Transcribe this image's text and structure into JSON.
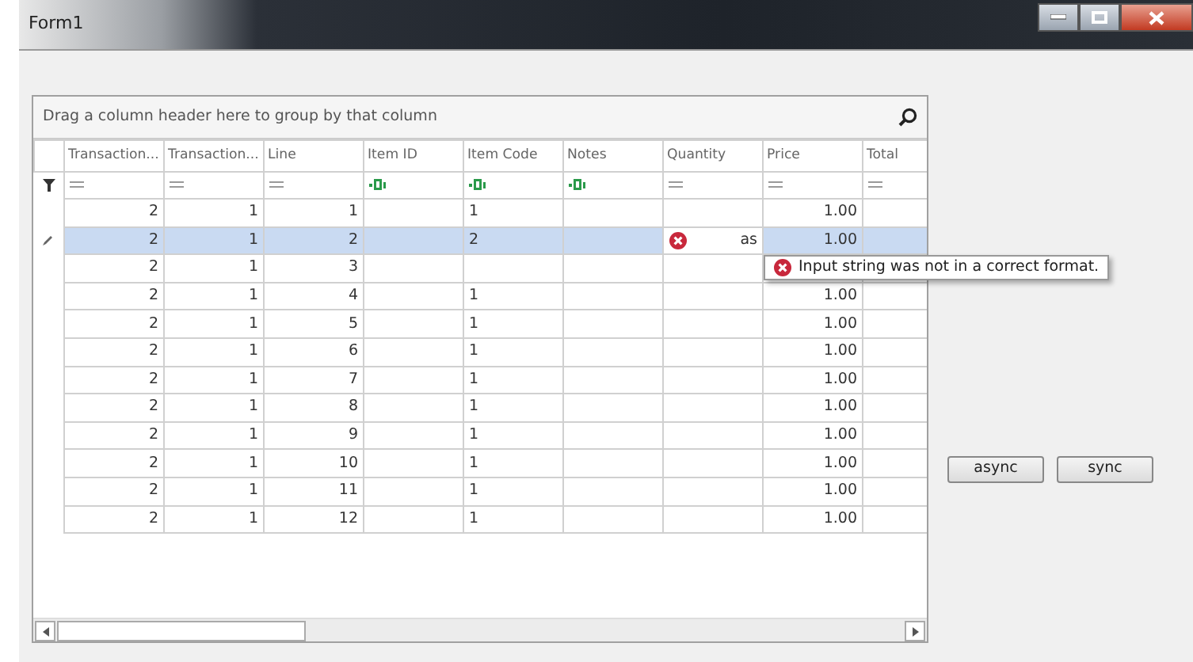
{
  "window": {
    "title": "Form1"
  },
  "grid": {
    "group_panel": "Drag a column header here to group by that column",
    "columns": [
      {
        "label": "Transaction...",
        "kind": "numeric"
      },
      {
        "label": "Transaction...",
        "kind": "numeric"
      },
      {
        "label": "Line",
        "kind": "numeric"
      },
      {
        "label": "Item ID",
        "kind": "text"
      },
      {
        "label": "Item Code",
        "kind": "text"
      },
      {
        "label": "Notes",
        "kind": "text"
      },
      {
        "label": "Quantity",
        "kind": "numeric"
      },
      {
        "label": "Price",
        "kind": "numeric"
      },
      {
        "label": "Total",
        "kind": "numeric"
      }
    ],
    "rows": [
      {
        "selected": false,
        "editing": false,
        "cells": [
          "2",
          "1",
          "1",
          null,
          "1",
          null,
          null,
          "1.00",
          null
        ]
      },
      {
        "selected": true,
        "editing": true,
        "cells": [
          "2",
          "1",
          "2",
          null,
          "2",
          null,
          {
            "value": "as",
            "error": true
          },
          "1.00",
          null
        ]
      },
      {
        "selected": false,
        "editing": false,
        "cells": [
          "2",
          "1",
          "3",
          null,
          null,
          null,
          null,
          null,
          null
        ]
      },
      {
        "selected": false,
        "editing": false,
        "cells": [
          "2",
          "1",
          "4",
          null,
          "1",
          null,
          null,
          "1.00",
          null
        ]
      },
      {
        "selected": false,
        "editing": false,
        "cells": [
          "2",
          "1",
          "5",
          null,
          "1",
          null,
          null,
          "1.00",
          null
        ]
      },
      {
        "selected": false,
        "editing": false,
        "cells": [
          "2",
          "1",
          "6",
          null,
          "1",
          null,
          null,
          "1.00",
          null
        ]
      },
      {
        "selected": false,
        "editing": false,
        "cells": [
          "2",
          "1",
          "7",
          null,
          "1",
          null,
          null,
          "1.00",
          null
        ]
      },
      {
        "selected": false,
        "editing": false,
        "cells": [
          "2",
          "1",
          "8",
          null,
          "1",
          null,
          null,
          "1.00",
          null
        ]
      },
      {
        "selected": false,
        "editing": false,
        "cells": [
          "2",
          "1",
          "9",
          null,
          "1",
          null,
          null,
          "1.00",
          null
        ]
      },
      {
        "selected": false,
        "editing": false,
        "cells": [
          "2",
          "1",
          "10",
          null,
          "1",
          null,
          null,
          "1.00",
          null
        ]
      },
      {
        "selected": false,
        "editing": false,
        "cells": [
          "2",
          "1",
          "11",
          null,
          "1",
          null,
          null,
          "1.00",
          null
        ]
      },
      {
        "selected": false,
        "editing": false,
        "cells": [
          "2",
          "1",
          "12",
          null,
          "1",
          null,
          null,
          "1.00",
          null
        ]
      }
    ],
    "error_tooltip": "Input string was not in a correct format."
  },
  "buttons": [
    "async",
    "sync"
  ]
}
